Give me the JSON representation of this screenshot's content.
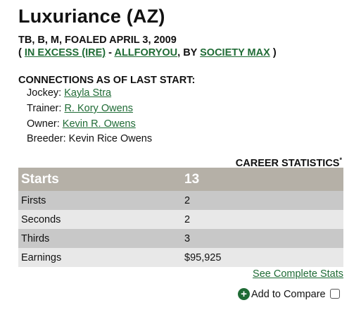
{
  "horse": {
    "name": "Luxuriance (AZ)",
    "foaled": "TB, B, M, FOALED APRIL 3, 2009",
    "sire": "IN EXCESS (IRE)",
    "dam": "ALLFORYOU",
    "by_label": ", BY",
    "damsire": "SOCIETY MAX",
    "open_paren": "(",
    "dash": "-",
    "close_paren": ")"
  },
  "connections": {
    "heading": "CONNECTIONS AS OF LAST START:",
    "jockey_label": "Jockey:",
    "jockey": "Kayla Stra",
    "trainer_label": "Trainer:",
    "trainer": "R. Kory Owens",
    "owner_label": "Owner:",
    "owner": "Kevin R. Owens",
    "breeder_label": "Breeder:",
    "breeder": "Kevin Rice Owens"
  },
  "stats": {
    "title": "CAREER STATISTICS",
    "asterisk": "*",
    "rows": [
      {
        "label": "Starts",
        "value": "13"
      },
      {
        "label": "Firsts",
        "value": "2"
      },
      {
        "label": "Seconds",
        "value": "2"
      },
      {
        "label": "Thirds",
        "value": "3"
      },
      {
        "label": "Earnings",
        "value": "$95,925"
      }
    ],
    "see_complete": "See Complete Stats",
    "add_compare": "Add to Compare"
  },
  "colors": {
    "link": "#1f6b35",
    "header_row": "#b5b0a7",
    "row_dark": "#c8c8c8",
    "row_light": "#e8e8e8"
  },
  "icons": {
    "add": "plus-circle-icon",
    "compare_checkbox": "checkbox"
  }
}
